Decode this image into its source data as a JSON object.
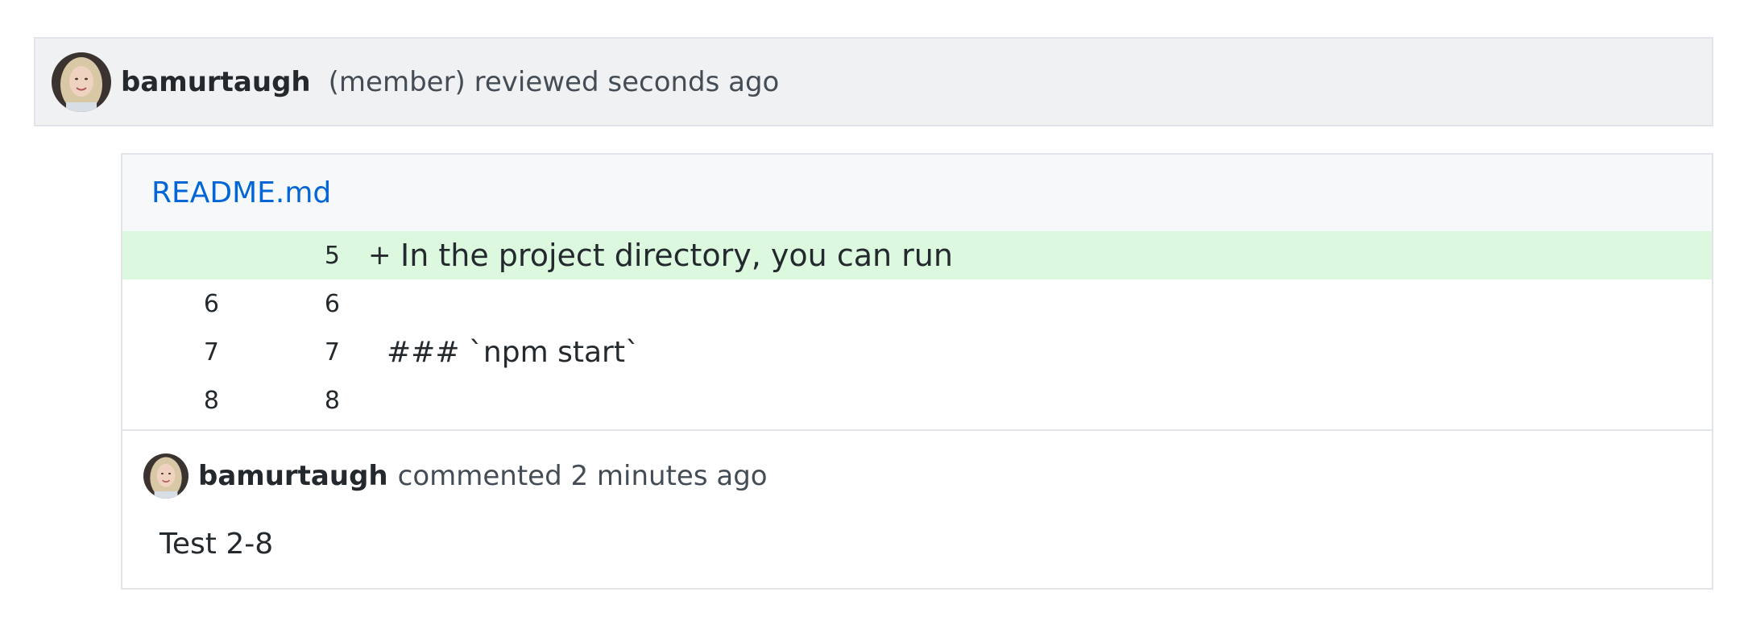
{
  "review": {
    "author": "bamurtaugh",
    "meta": "(member) reviewed seconds ago",
    "avatar_icon": "user-avatar"
  },
  "file": {
    "name": "README.md",
    "diff": [
      {
        "old": "",
        "new": "5",
        "marker": "+",
        "text": "In the project directory, you can run",
        "type": "added"
      },
      {
        "old": "6",
        "new": "6",
        "marker": "",
        "text": "",
        "type": "context"
      },
      {
        "old": "7",
        "new": "7",
        "marker": "",
        "text": "### `npm start`",
        "type": "context"
      },
      {
        "old": "8",
        "new": "8",
        "marker": "",
        "text": "",
        "type": "context"
      }
    ]
  },
  "comment": {
    "author": "bamurtaugh",
    "meta": "commented 2 minutes ago",
    "body": "Test 2-8",
    "avatar_icon": "user-avatar"
  },
  "colors": {
    "link": "#0366d6",
    "added_bg": "#dcf9e0",
    "header_bg": "#f0f1f3"
  }
}
